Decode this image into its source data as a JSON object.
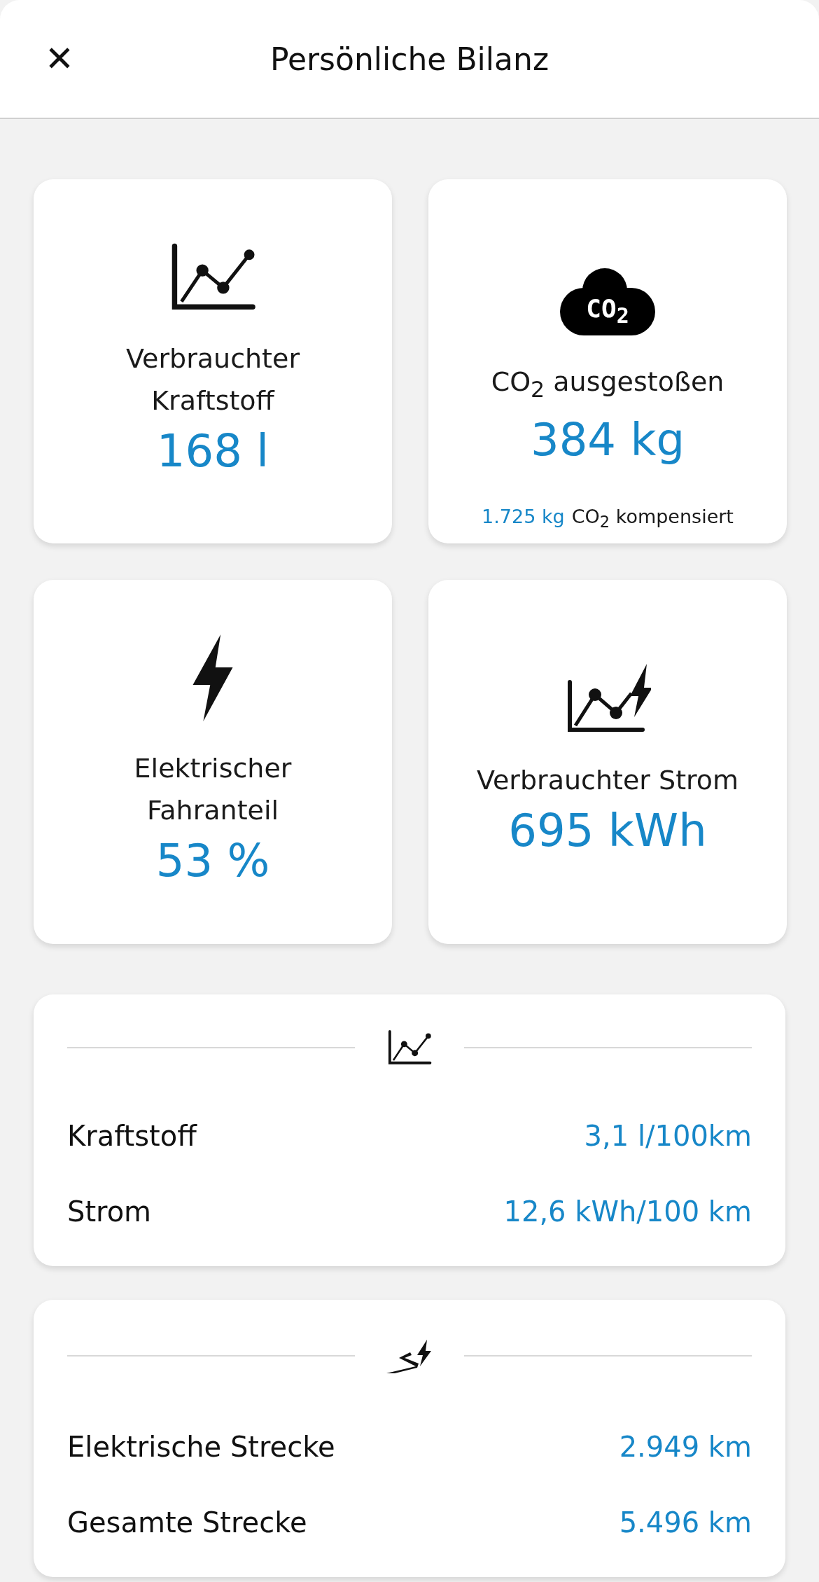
{
  "header": {
    "close": "✕",
    "title": "Persönliche Bilanz"
  },
  "tiles": [
    {
      "kind": "chart",
      "title": "Verbrauchter\nKraftstoff",
      "value": "168 l"
    },
    {
      "kind": "co2",
      "icon_label": "CO$_{2}$",
      "title": "CO$_{2}$ ausgestoßen",
      "value": "384 kg",
      "compensated_value": "1.725 kg",
      "compensated_label": "CO$_{2}$ kompensiert"
    },
    {
      "kind": "bolt",
      "title": "Elektrischer\nFahranteil",
      "value": "53 %"
    },
    {
      "kind": "chartbolt",
      "title": "Verbrauchter Strom",
      "value": "695 kWh"
    }
  ],
  "sections": [
    {
      "kind": "chart",
      "rows": [
        {
          "label": "Kraftstoff",
          "value": "3,1 l/100km"
        },
        {
          "label": "Strom",
          "value": "12,6 kWh/100 km"
        }
      ]
    },
    {
      "kind": "road",
      "rows": [
        {
          "label": "Elektrische Strecke",
          "value": "2.949 km"
        },
        {
          "label": "Gesamte Strecke",
          "value": "5.496 km"
        }
      ]
    }
  ]
}
